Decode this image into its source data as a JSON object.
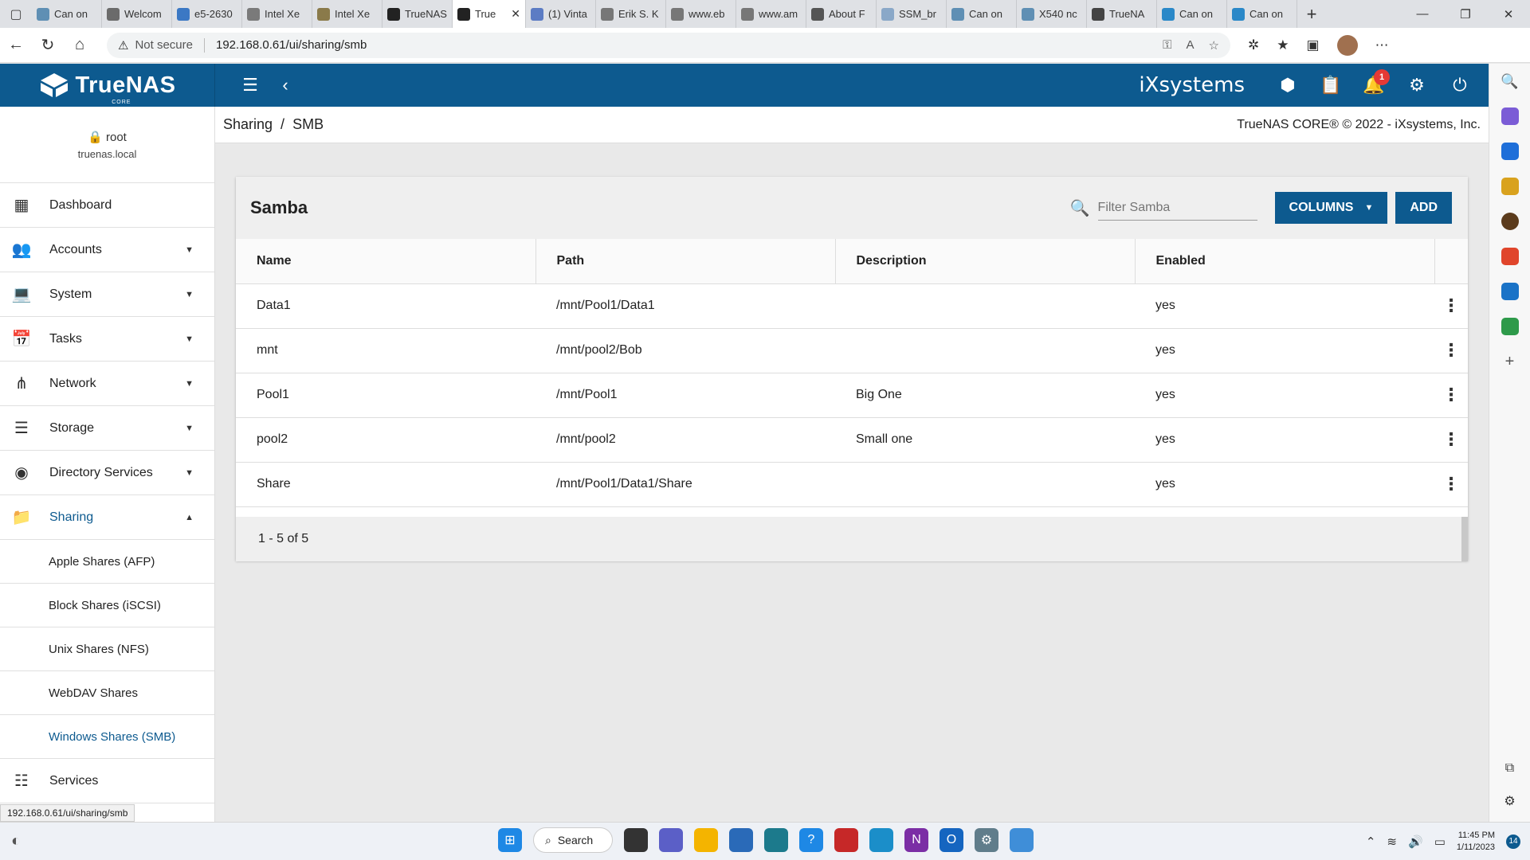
{
  "browser": {
    "tabs": [
      {
        "label": "Can on",
        "color": "#5f8fb4"
      },
      {
        "label": "Welcom",
        "color": "#6b6b6b"
      },
      {
        "label": "e5-2630",
        "color": "#3b78c4"
      },
      {
        "label": "Intel Xe",
        "color": "#7a7a7a"
      },
      {
        "label": "Intel Xe",
        "color": "#8a7a4a"
      },
      {
        "label": "TrueNAS",
        "color": "#222222"
      },
      {
        "label": "True",
        "color": "#222222",
        "active": true
      },
      {
        "label": "(1) Vinta",
        "color": "#5c7cc4"
      },
      {
        "label": "Erik S. K",
        "color": "#777777"
      },
      {
        "label": "www.eb",
        "color": "#777777"
      },
      {
        "label": "www.am",
        "color": "#777777"
      },
      {
        "label": "About F",
        "color": "#555555"
      },
      {
        "label": "SSM_br",
        "color": "#8aa8c8"
      },
      {
        "label": "Can on",
        "color": "#5f8fb4"
      },
      {
        "label": "X540 nc",
        "color": "#5f8fb4"
      },
      {
        "label": "TrueNA",
        "color": "#444444"
      },
      {
        "label": "Can on",
        "color": "#2a88c8"
      },
      {
        "label": "Can on",
        "color": "#2a88c8"
      }
    ],
    "not_secure": "Not secure",
    "url": "192.168.0.61/ui/sharing/smb",
    "status_url": "192.168.0.61/ui/sharing/smb"
  },
  "header": {
    "brand": "TrueNAS",
    "brand_sub": "CORE",
    "vendor_logo": "iXsystems",
    "notification_count": "1"
  },
  "user": {
    "name": "root",
    "host": "truenas.local"
  },
  "nav": {
    "items": [
      {
        "label": "Dashboard",
        "icon": "dashboard-icon",
        "caret": false
      },
      {
        "label": "Accounts",
        "icon": "people-icon",
        "caret": true
      },
      {
        "label": "System",
        "icon": "laptop-icon",
        "caret": true
      },
      {
        "label": "Tasks",
        "icon": "calendar-icon",
        "caret": true
      },
      {
        "label": "Network",
        "icon": "network-icon",
        "caret": true
      },
      {
        "label": "Storage",
        "icon": "storage-icon",
        "caret": true
      },
      {
        "label": "Directory Services",
        "icon": "directory-icon",
        "caret": true
      },
      {
        "label": "Sharing",
        "icon": "folder-shared-icon",
        "caret": true,
        "open": true
      }
    ],
    "sub_items": [
      {
        "label": "Apple Shares (AFP)"
      },
      {
        "label": "Block Shares (iSCSI)"
      },
      {
        "label": "Unix Shares (NFS)"
      },
      {
        "label": "WebDAV Shares"
      },
      {
        "label": "Windows Shares (SMB)",
        "active": true
      }
    ],
    "after": {
      "label": "Services",
      "icon": "tune-icon"
    }
  },
  "breadcrumb": {
    "parent": "Sharing",
    "current": "SMB",
    "copyright": "TrueNAS CORE® © 2022 - iXsystems, Inc."
  },
  "card": {
    "title": "Samba",
    "filter_placeholder": "Filter Samba",
    "columns_label": "COLUMNS",
    "add_label": "ADD",
    "headers": [
      "Name",
      "Path",
      "Description",
      "Enabled"
    ],
    "rows": [
      {
        "name": "Data1",
        "path": "/mnt/Pool1/Data1",
        "description": "",
        "enabled": "yes"
      },
      {
        "name": "mnt",
        "path": "/mnt/pool2/Bob",
        "description": "",
        "enabled": "yes"
      },
      {
        "name": "Pool1",
        "path": "/mnt/Pool1",
        "description": "Big One",
        "enabled": "yes"
      },
      {
        "name": "pool2",
        "path": "/mnt/pool2",
        "description": "Small one",
        "enabled": "yes"
      },
      {
        "name": "Share",
        "path": "/mnt/Pool1/Data1/Share",
        "description": "",
        "enabled": "yes"
      }
    ],
    "pagination": "1 - 5 of 5"
  },
  "taskbar": {
    "search_label": "Search",
    "time": "11:45 PM",
    "date": "1/11/2023",
    "notification_count": "14"
  }
}
